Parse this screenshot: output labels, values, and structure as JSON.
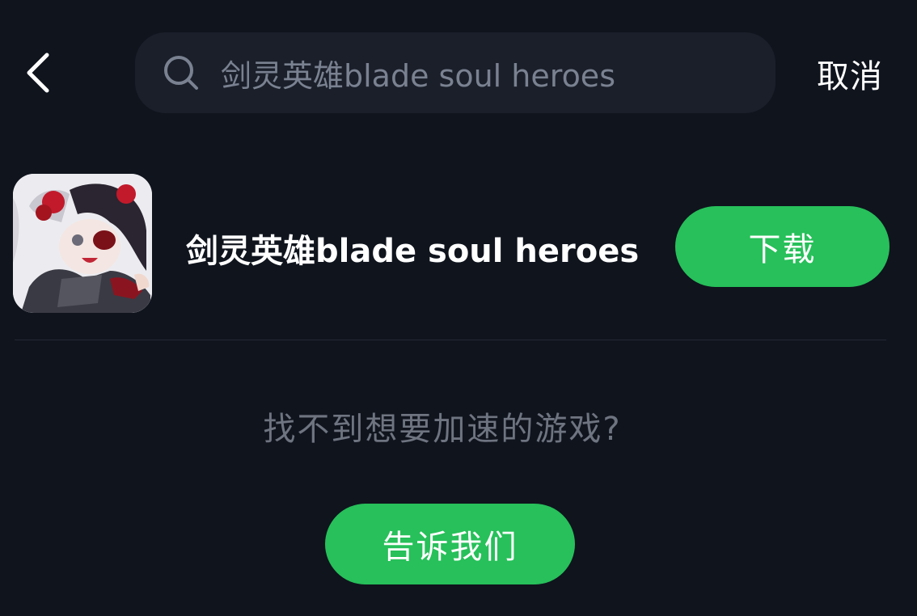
{
  "header": {
    "back_icon": "chevron-left-icon",
    "search": {
      "icon": "search-icon",
      "value": "剑灵英雄blade soul heroes"
    },
    "cancel_label": "取消"
  },
  "result": {
    "app_icon": "game-character-artwork",
    "title": "剑灵英雄blade soul heroes",
    "download_label": "下载"
  },
  "footer": {
    "hint": "找不到想要加速的游戏?",
    "tell_us_label": "告诉我们"
  },
  "colors": {
    "background": "#0f141d",
    "search_bg": "#1a1f2a",
    "accent_green": "#27c05a",
    "muted_text": "#6f7481"
  }
}
